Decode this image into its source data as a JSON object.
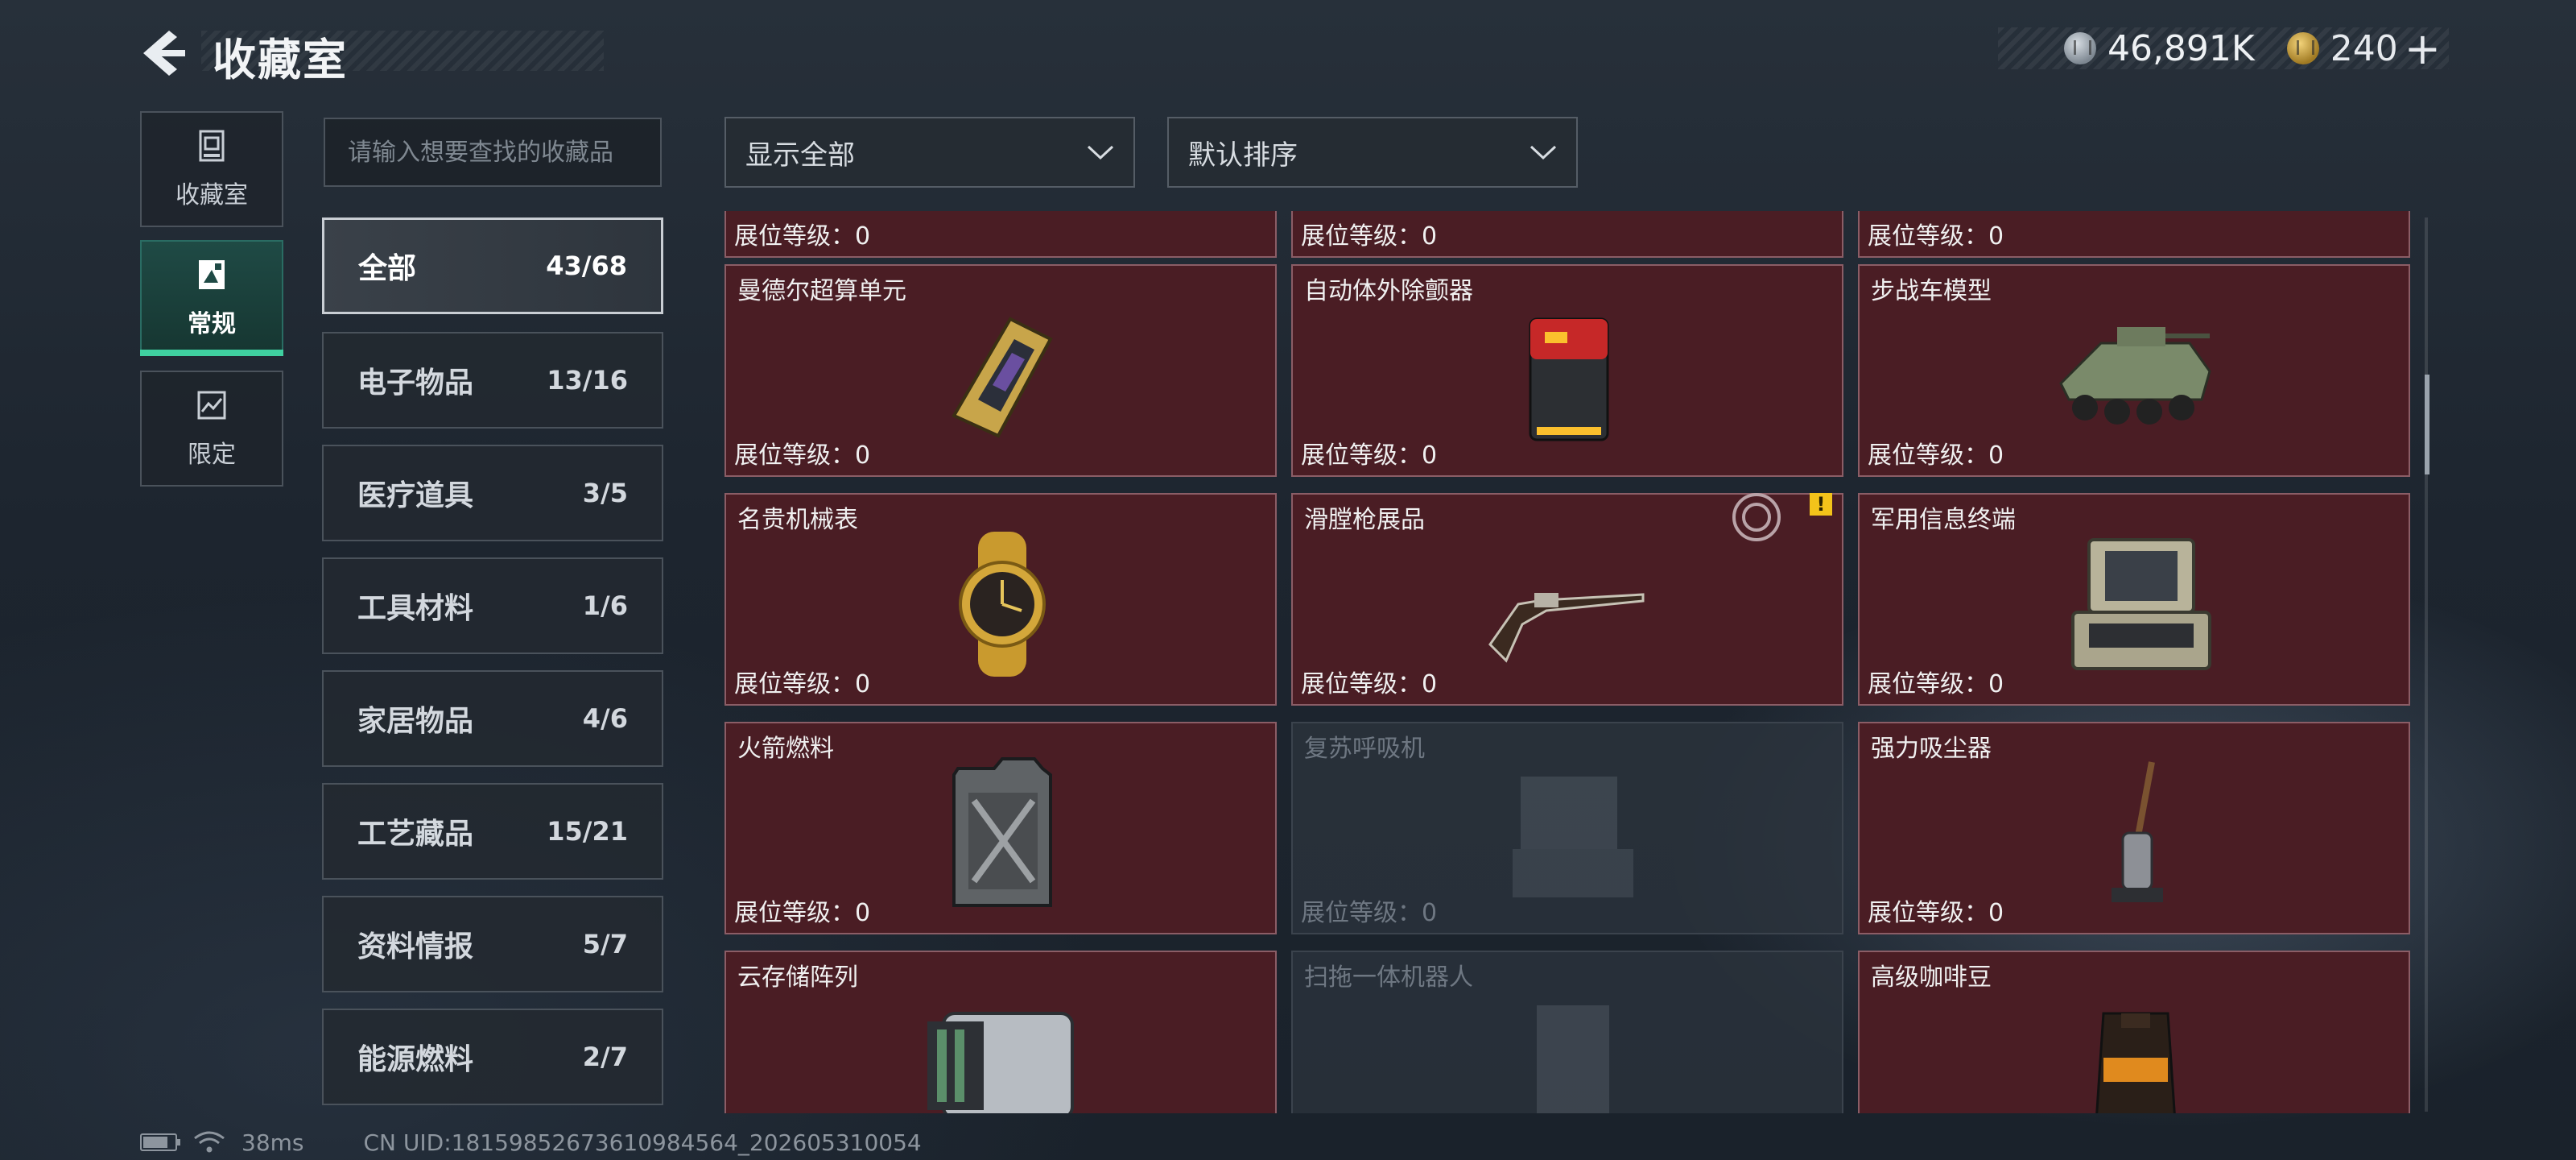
{
  "header": {
    "title": "收藏室",
    "currency": [
      {
        "icon": "silver-coin-icon",
        "value": "46,891K"
      },
      {
        "icon": "gold-coin-icon",
        "value": "240"
      }
    ],
    "add_label": "+"
  },
  "rail": [
    {
      "label": "收藏室",
      "icon": "collection-room-icon"
    },
    {
      "label": "常规",
      "icon": "regular-icon",
      "active": true
    },
    {
      "label": "限定",
      "icon": "limited-icon"
    }
  ],
  "search": {
    "placeholder": "请输入想要查找的收藏品"
  },
  "filters": {
    "display": "显示全部",
    "sort": "默认排序"
  },
  "categories": [
    {
      "label": "全部",
      "count": "43/68",
      "active": true
    },
    {
      "label": "电子物品",
      "count": "13/16"
    },
    {
      "label": "医疗道具",
      "count": "3/5"
    },
    {
      "label": "工具材料",
      "count": "1/6"
    },
    {
      "label": "家居物品",
      "count": "4/6"
    },
    {
      "label": "工艺藏品",
      "count": "15/21"
    },
    {
      "label": "资料情报",
      "count": "5/7"
    },
    {
      "label": "能源燃料",
      "count": "2/7"
    }
  ],
  "grid": {
    "level_label": "展位等级：",
    "level_value": "0",
    "items": [
      {
        "name": "",
        "level": "展位等级：0",
        "locked": false,
        "partial": true
      },
      {
        "name": "",
        "level": "展位等级：0",
        "locked": false,
        "partial": true
      },
      {
        "name": "",
        "level": "展位等级：0",
        "locked": false,
        "partial": true
      },
      {
        "name": "曼德尔超算单元",
        "level": "展位等级：0",
        "locked": false,
        "icon": "supercomputer-unit-icon"
      },
      {
        "name": "自动体外除颤器",
        "level": "展位等级：0",
        "locked": false,
        "icon": "defibrillator-icon"
      },
      {
        "name": "步战车模型",
        "level": "展位等级：0",
        "locked": false,
        "icon": "armored-vehicle-model-icon"
      },
      {
        "name": "名贵机械表",
        "level": "展位等级：0",
        "locked": false,
        "icon": "mechanical-watch-icon"
      },
      {
        "name": "滑膛枪展品",
        "level": "展位等级：0",
        "locked": false,
        "icon": "musket-icon",
        "alert": "!"
      },
      {
        "name": "军用信息终端",
        "level": "展位等级：0",
        "locked": false,
        "icon": "military-terminal-icon"
      },
      {
        "name": "火箭燃料",
        "level": "展位等级：0",
        "locked": false,
        "icon": "fuel-canister-icon"
      },
      {
        "name": "复苏呼吸机",
        "level": "展位等级：0",
        "locked": true,
        "icon": "ventilator-icon"
      },
      {
        "name": "强力吸尘器",
        "level": "展位等级：0",
        "locked": false,
        "icon": "vacuum-cleaner-icon"
      },
      {
        "name": "云存储阵列",
        "level": "",
        "locked": false,
        "icon": "cloud-storage-array-icon"
      },
      {
        "name": "扫拖一体机器人",
        "level": "",
        "locked": true,
        "icon": "mop-robot-icon"
      },
      {
        "name": "高级咖啡豆",
        "level": "",
        "locked": false,
        "icon": "coffee-beans-icon"
      }
    ]
  },
  "footer": {
    "ping": "38ms",
    "uid": "CN UID:18159852673610984564_202605310054"
  },
  "colors": {
    "card_bg": "#4a1d24",
    "card_border": "#8b5d66",
    "accent": "#3fd0a0",
    "alert": "#f3c31a"
  }
}
